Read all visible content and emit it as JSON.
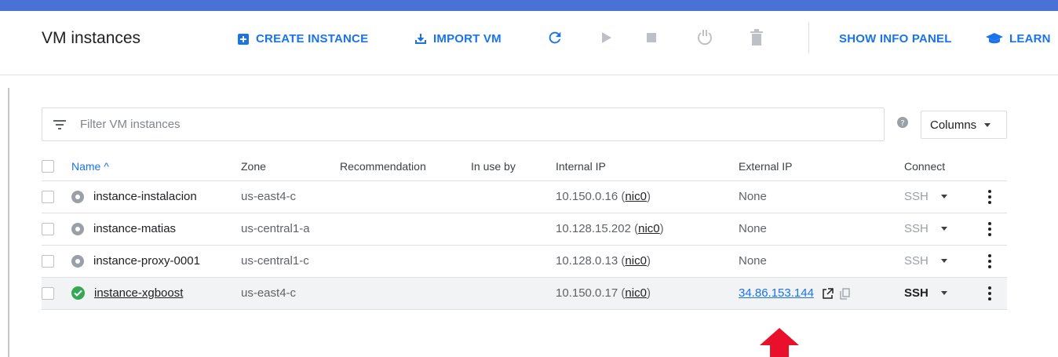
{
  "header": {
    "title": "VM instances",
    "create_instance": "CREATE INSTANCE",
    "import_vm": "IMPORT VM",
    "show_info_panel": "SHOW INFO PANEL",
    "learn": "LEARN"
  },
  "filter": {
    "placeholder": "Filter VM instances",
    "columns_label": "Columns"
  },
  "table": {
    "headers": {
      "name": "Name ^",
      "zone": "Zone",
      "recommendation": "Recommendation",
      "in_use_by": "In use by",
      "internal_ip": "Internal IP",
      "external_ip": "External IP",
      "connect": "Connect"
    },
    "rows": [
      {
        "status": "stopped",
        "name": "instance-instalacion",
        "zone": "us-east4-c",
        "internal_ip": "10.150.0.16",
        "nic": "nic0",
        "external_ip": "None",
        "connect": "SSH"
      },
      {
        "status": "stopped",
        "name": "instance-matias",
        "zone": "us-central1-a",
        "internal_ip": "10.128.15.202",
        "nic": "nic0",
        "external_ip": "None",
        "connect": "SSH"
      },
      {
        "status": "stopped",
        "name": "instance-proxy-0001",
        "zone": "us-central1-c",
        "internal_ip": "10.128.0.13",
        "nic": "nic0",
        "external_ip": "None",
        "connect": "SSH"
      },
      {
        "status": "running",
        "name": "instance-xgboost",
        "zone": "us-east4-c",
        "internal_ip": "10.150.0.17",
        "nic": "nic0",
        "external_ip": "34.86.153.144",
        "connect": "SSH"
      }
    ]
  },
  "colors": {
    "accent": "#1a73e8",
    "topbar": "#4a72d6",
    "running": "#34a853",
    "stopped": "#9aa0a6",
    "arrow": "#e8102a"
  },
  "icons": [
    "create-instance-icon",
    "import-vm-icon",
    "refresh-icon",
    "start-icon",
    "stop-icon",
    "reset-icon",
    "delete-icon",
    "learn-icon",
    "filter-icon",
    "help-icon",
    "caret-down-icon",
    "external-link-icon",
    "copy-icon",
    "more-vert-icon",
    "red-arrow-icon"
  ]
}
